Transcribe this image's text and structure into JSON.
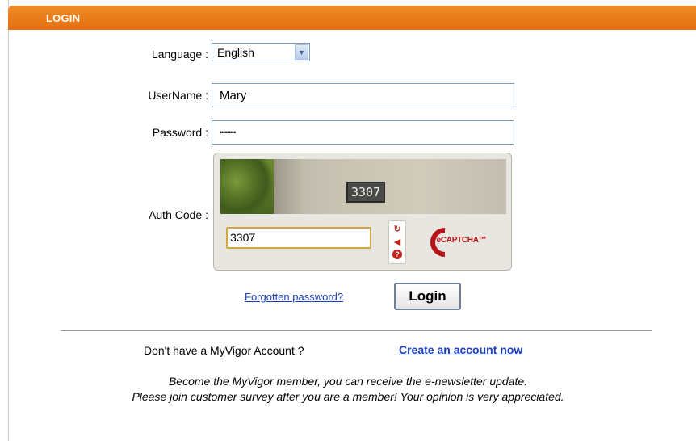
{
  "header": {
    "title": "LOGIN"
  },
  "form": {
    "language_label": "Language :",
    "language_value": "English",
    "username_label": "UserName :",
    "username_value": "Mary",
    "password_label": "Password :",
    "password_value": "•••••••••",
    "authcode_label": "Auth Code :"
  },
  "captcha": {
    "image_text": "3307",
    "input_value": "3307",
    "reload_icon": "reload-icon",
    "audio_icon": "audio-icon",
    "help_icon": "help-icon",
    "logo_text": "reCAPTCHA™"
  },
  "actions": {
    "forgot_label": "Forgotten password?",
    "login_label": "Login"
  },
  "footer": {
    "no_account_text": "Don't have a MyVigor Account ?",
    "create_label": "Create an account now",
    "message_line1": "Become the MyVigor member, you can receive the e-newsletter update.",
    "message_line2": "Please join customer survey after you are a member! Your opinion is very appreciated."
  },
  "colors": {
    "header": "#e97a18",
    "link": "#1a3fbf"
  }
}
